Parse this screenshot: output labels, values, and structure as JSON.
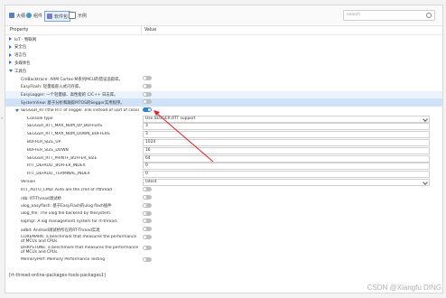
{
  "toolbar": {
    "tabs": [
      {
        "label": "大纲",
        "icon": "outline-icon",
        "active": false
      },
      {
        "label": "组件",
        "icon": "component-icon",
        "active": false
      },
      {
        "label": "软件包",
        "icon": "package-icon",
        "active": true
      },
      {
        "label": "示例",
        "icon": "example-icon",
        "active": false
      }
    ],
    "search_placeholder": "search"
  },
  "header": {
    "property": "Property",
    "value": "Value"
  },
  "rows": [
    {
      "label": "IoT - 物联网",
      "indent": 0,
      "type": "group",
      "expanded": false
    },
    {
      "label": "安全包",
      "indent": 0,
      "type": "group",
      "expanded": false
    },
    {
      "label": "语言包",
      "indent": 0,
      "type": "group",
      "expanded": false
    },
    {
      "label": "多媒体包",
      "indent": 0,
      "type": "group",
      "expanded": false
    },
    {
      "label": "工具包",
      "indent": 0,
      "type": "group",
      "expanded": true
    },
    {
      "label": "CmBacktrace: ARM Cortex-M系列MCU的错误追踪库。",
      "indent": 1,
      "type": "toggle",
      "on": false
    },
    {
      "label": "EasyFlash: 轻量级嵌入式闪存库。",
      "indent": 1,
      "type": "toggle",
      "on": false
    },
    {
      "label": "EasyLogger: 一个轻量级、高性能的 C/C++ 日志库。",
      "indent": 1,
      "type": "toggle",
      "on": false,
      "hl": true
    },
    {
      "label": "SystemView: 基于分析和跟踪MTOS的Segger实用程序。",
      "indent": 1,
      "type": "toggle",
      "on": false,
      "sel": true
    },
    {
      "label": "SEGGER_RTT:the RTT of segger ,link instead of uart of console",
      "indent": 1,
      "type": "toggle",
      "on": true,
      "expanded": true
    },
    {
      "label": "Console type",
      "indent": 2,
      "type": "select",
      "value": "Use SEGGER RTT support"
    },
    {
      "label": "SEGGER_RTT_MAX_NUM_UP_BUFFERS",
      "indent": 2,
      "type": "input",
      "value": "3"
    },
    {
      "label": "SEGGER_RTT_MAX_NUM_DOWN_BUFFERS",
      "indent": 2,
      "type": "input",
      "value": "3"
    },
    {
      "label": "BUFFER_SIZE_UP",
      "indent": 2,
      "type": "input",
      "value": "1024"
    },
    {
      "label": "BUFFER_SIZE_DOWN",
      "indent": 2,
      "type": "input",
      "value": "16"
    },
    {
      "label": "SEGGER_RTT_PRINTF_BUFFER_SIZE",
      "indent": 2,
      "type": "input",
      "value": "64"
    },
    {
      "label": "RTT_DEFAULT_BUFFER_INDEX",
      "indent": 2,
      "type": "input",
      "value": "0"
    },
    {
      "label": "RTT_DEFAULT_TERMINAL_INDEX",
      "indent": 2,
      "type": "input",
      "value": "0"
    },
    {
      "label": "Version",
      "indent": 1,
      "type": "select",
      "value": "latest"
    },
    {
      "label": "RTT_AUTO_CMD: Auto are the cmd of rtthread",
      "indent": 1,
      "type": "toggle",
      "on": false
    },
    {
      "label": "rdb: RT-Thread调试桥",
      "indent": 1,
      "type": "toggle",
      "on": false
    },
    {
      "label": "ulog_easyflash: 基于EasyFlash的ulog flash插件",
      "indent": 1,
      "type": "toggle",
      "on": false
    },
    {
      "label": "ulog_file: The ulog file backend by filesystem.",
      "indent": 1,
      "type": "toggle",
      "on": false
    },
    {
      "label": "logmgr: A log management system for rt-thread.",
      "indent": 1,
      "type": "toggle",
      "on": false
    },
    {
      "label": "adbd: Android调试桥所在的RT-Thread实现",
      "indent": 1,
      "type": "toggle",
      "on": false
    },
    {
      "label": "COREMARK: a benchmark that measures the performance of MCUs and CPUs.",
      "indent": 1,
      "type": "toggle",
      "on": false,
      "tall": true
    },
    {
      "label": "DHRYSTONE: a benchmark that measures the performance of MCUs and CPUs.",
      "indent": 1,
      "type": "toggle",
      "on": false,
      "tall": true
    },
    {
      "label": "MemoryPerf: Memory Performance Testing",
      "indent": 1,
      "type": "toggle",
      "on": false
    }
  ],
  "footer_text": "[rt-thread-online-packages-tools-packages1]",
  "watermark": "CSDN @Xiangfu DING",
  "splitter_glyph": "«",
  "colors": {
    "accent": "#2f7fe0",
    "selected": "#cfe2f7",
    "arrow": "#e02020"
  }
}
